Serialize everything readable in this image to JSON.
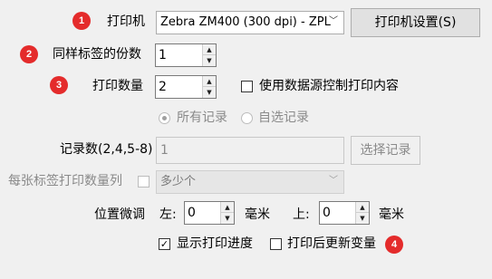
{
  "badges": [
    "1",
    "2",
    "3",
    "4"
  ],
  "printer": {
    "label": "打印机",
    "selected": "Zebra ZM400 (300 dpi) - ZPL",
    "settings_button": "打印机设置(S)"
  },
  "copies": {
    "label": "同样标签的份数",
    "value": "1"
  },
  "quantity": {
    "label": "打印数量",
    "value": "2",
    "datasource_checkbox_label": "使用数据源控制打印内容",
    "datasource_checked": false
  },
  "records": {
    "all_label": "所有记录",
    "custom_label": "自选记录",
    "all_selected": true,
    "count_label": "记录数(2,4,5-8)",
    "count_value": "1",
    "select_button": "选择记录"
  },
  "per_label": {
    "label": "每张标签打印数量列",
    "checked": false,
    "selected": "多少个"
  },
  "offset": {
    "label": "位置微调",
    "left_label": "左:",
    "left_value": "0",
    "left_unit": "毫米",
    "top_label": "上:",
    "top_value": "0",
    "top_unit": "毫米"
  },
  "options": {
    "show_progress_label": "显示打印进度",
    "show_progress_checked": true,
    "update_vars_label": "打印后更新变量",
    "update_vars_checked": false
  },
  "icons": {
    "dropdown_arrow": "chevron-down-icon",
    "spin_up": "triangle-up-icon",
    "spin_down": "triangle-down-icon",
    "check": "check-icon"
  },
  "colors": {
    "badge": "#e42b2b",
    "background": "#f0f0f0"
  }
}
